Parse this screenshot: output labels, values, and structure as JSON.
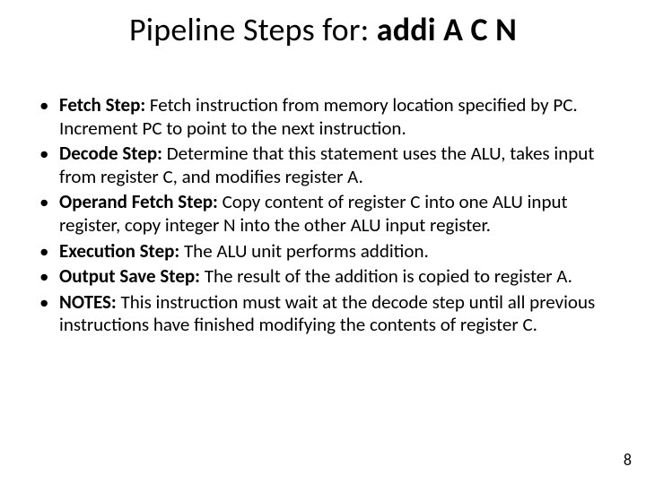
{
  "title": {
    "prefix": "Pipeline Steps for: ",
    "bold": "addi A C N"
  },
  "bullets": [
    {
      "label": "Fetch Step:",
      "text": " Fetch instruction from memory location specified by PC. Increment PC to point to the next instruction."
    },
    {
      "label": "Decode Step:",
      "text": " Determine that this statement uses the ALU, takes input from register C, and modifies register A."
    },
    {
      "label": "Operand Fetch Step:",
      "text": " Copy content of register C into one ALU input register, copy integer N into the other ALU input register."
    },
    {
      "label": "Execution Step:",
      "text": " The ALU unit performs addition."
    },
    {
      "label": "Output Save Step:",
      "text": " The result of the addition is copied to register A."
    }
  ],
  "notes": {
    "label": "NOTES:",
    "text": " This instruction must wait at the decode step until all previous instructions have finished modifying the contents of register C."
  },
  "page_number": "8"
}
